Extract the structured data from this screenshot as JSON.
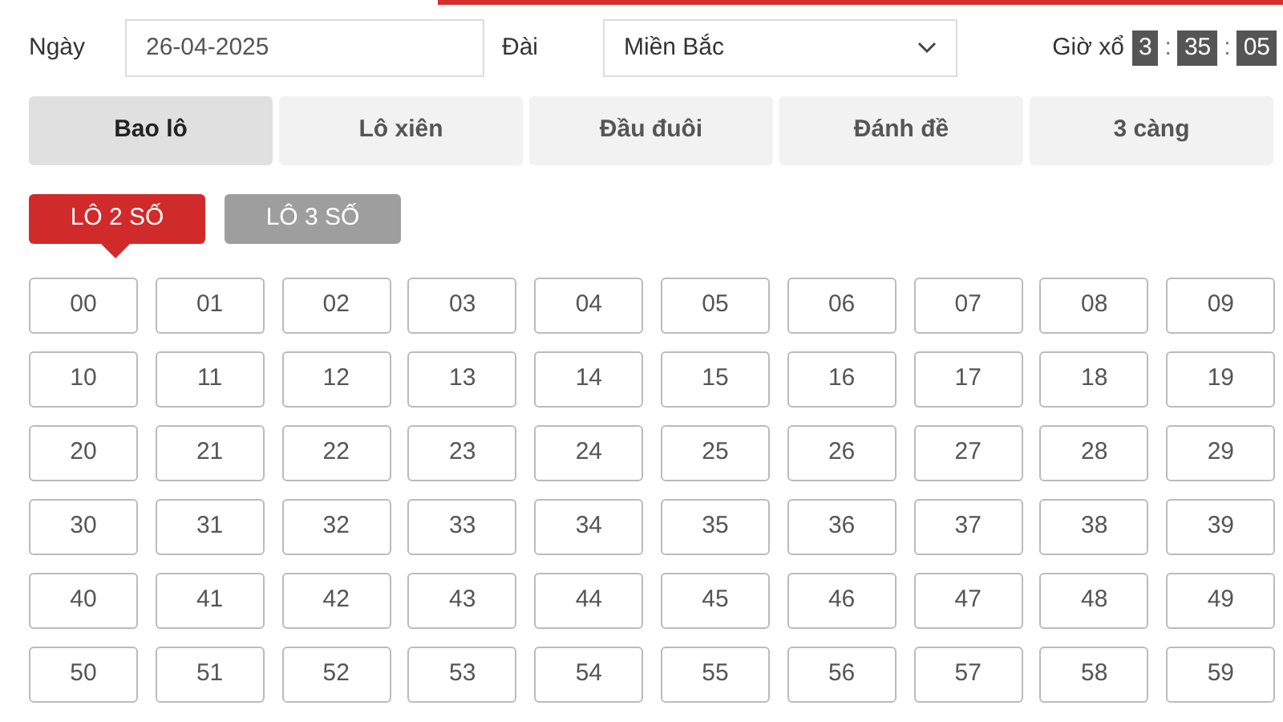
{
  "date_label": "Ngày",
  "date_value": "26-04-2025",
  "region_label": "Đài",
  "region_select": "Miền Bắc",
  "countdown": {
    "label": "Giờ xổ",
    "hours": "3",
    "minutes": "35",
    "seconds": "05",
    "separator": ":"
  },
  "tabs": [
    {
      "label": "Bao lô",
      "selected": true
    },
    {
      "label": "Lô xiên",
      "selected": false
    },
    {
      "label": "Đầu đuôi",
      "selected": false
    },
    {
      "label": "Đánh đề",
      "selected": false
    },
    {
      "label": "3 càng",
      "selected": false
    }
  ],
  "modes": [
    {
      "label": "LÔ 2 SỐ",
      "selected": true
    },
    {
      "label": "LÔ 3 SỐ",
      "selected": false
    }
  ],
  "numbers": [
    "00",
    "01",
    "02",
    "03",
    "04",
    "05",
    "06",
    "07",
    "08",
    "09",
    "10",
    "11",
    "12",
    "13",
    "14",
    "15",
    "16",
    "17",
    "18",
    "19",
    "20",
    "21",
    "22",
    "23",
    "24",
    "25",
    "26",
    "27",
    "28",
    "29",
    "30",
    "31",
    "32",
    "33",
    "34",
    "35",
    "36",
    "37",
    "38",
    "39",
    "40",
    "41",
    "42",
    "43",
    "44",
    "45",
    "46",
    "47",
    "48",
    "49",
    "50",
    "51",
    "52",
    "53",
    "54",
    "55",
    "56",
    "57",
    "58",
    "59"
  ]
}
